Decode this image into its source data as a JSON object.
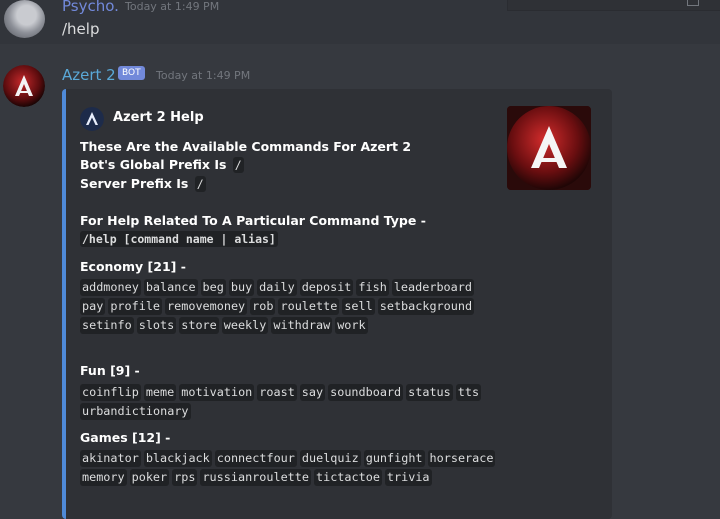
{
  "message1": {
    "username": "Psycho.",
    "timestamp": "Today at 1:49 PM",
    "content": "/help"
  },
  "message2": {
    "username": "Azert 2",
    "badge": "BOT",
    "timestamp": "Today at 1:49 PM"
  },
  "embed": {
    "author": "Azert 2 Help",
    "accent_color": "#4f8ad8",
    "intro_line1": "These Are the Available Commands For Azert 2",
    "global_prefix_label": "Bot's Global Prefix Is",
    "global_prefix": "/",
    "server_prefix_label": "Server Prefix Is",
    "server_prefix": "/",
    "help_line": "For Help Related To A Particular Command Type -",
    "help_usage": "/help [command name | alias]",
    "categories": [
      {
        "title": "Economy [21] -",
        "commands": [
          "addmoney",
          "balance",
          "beg",
          "buy",
          "daily",
          "deposit",
          "fish",
          "leaderboard",
          "pay",
          "profile",
          "removemoney",
          "rob",
          "roulette",
          "sell",
          "setbackground",
          "setinfo",
          "slots",
          "store",
          "weekly",
          "withdraw",
          "work"
        ]
      },
      {
        "title": "Fun [9] -",
        "commands": [
          "coinflip",
          "meme",
          "motivation",
          "roast",
          "say",
          "soundboard",
          "status",
          "tts",
          "urbandictionary"
        ]
      },
      {
        "title": "Games [12] -",
        "commands": [
          "akinator",
          "blackjack",
          "connectfour",
          "duelquiz",
          "gunfight",
          "horserace",
          "memory",
          "poker",
          "rps",
          "russianroulette",
          "tictactoe",
          "trivia"
        ]
      }
    ]
  }
}
